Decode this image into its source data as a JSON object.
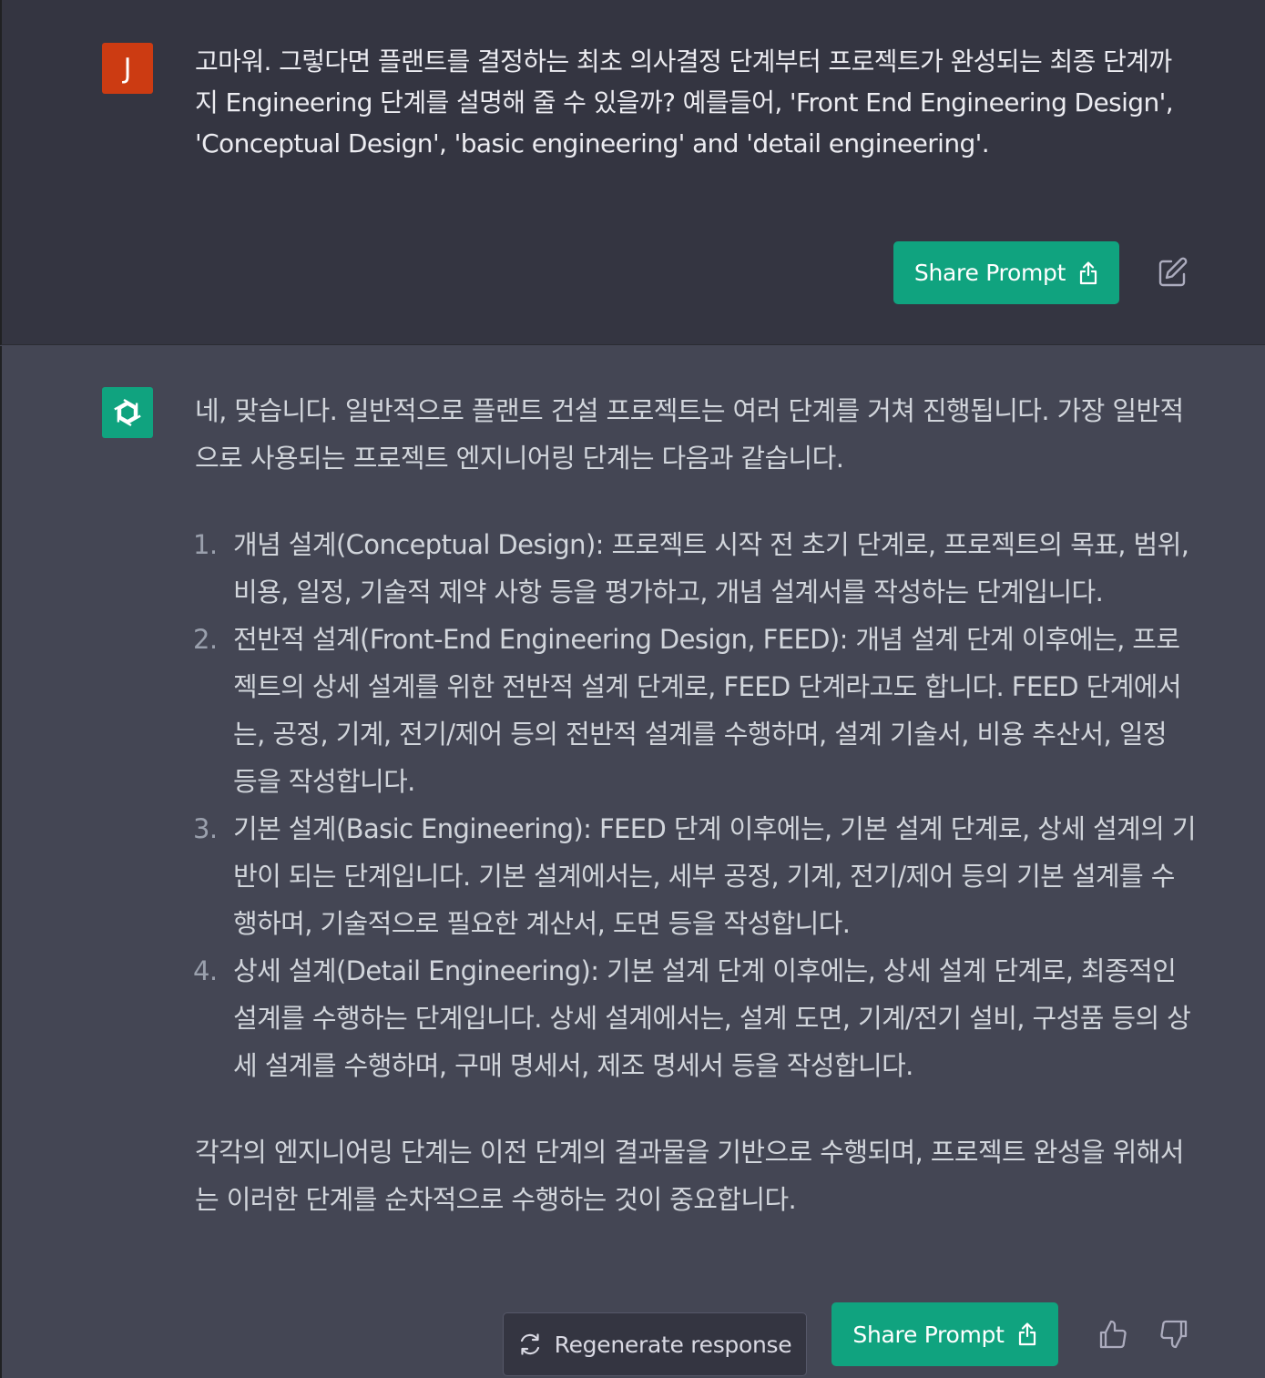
{
  "user_message": {
    "avatar_letter": "J",
    "text": "고마워. 그렇다면 플랜트를 결정하는 최초 의사결정 단계부터 프로젝트가 완성되는 최종 단계까지 Engineering 단계를 설명해 줄 수 있을까? 예를들어, 'Front End Engineering Design', 'Conceptual Design', 'basic engineering' and 'detail engineering'.",
    "share_label": "Share Prompt"
  },
  "assistant_message": {
    "intro": "네, 맞습니다. 일반적으로 플랜트 건설 프로젝트는 여러 단계를 거쳐 진행됩니다. 가장 일반적으로 사용되는 프로젝트 엔지니어링 단계는 다음과 같습니다.",
    "items": [
      {
        "num": "1.",
        "text": "개념 설계(Conceptual Design): 프로젝트 시작 전 초기 단계로, 프로젝트의 목표, 범위, 비용, 일정, 기술적 제약 사항 등을 평가하고, 개념 설계서를 작성하는 단계입니다."
      },
      {
        "num": "2.",
        "text": "전반적 설계(Front-End Engineering Design, FEED): 개념 설계 단계 이후에는, 프로젝트의 상세 설계를 위한 전반적 설계 단계로, FEED 단계라고도 합니다. FEED 단계에서는, 공정, 기계, 전기/제어 등의 전반적 설계를 수행하며, 설계 기술서, 비용 추산서, 일정 등을 작성합니다."
      },
      {
        "num": "3.",
        "text": "기본 설계(Basic Engineering): FEED 단계 이후에는, 기본 설계 단계로, 상세 설계의 기반이 되는 단계입니다. 기본 설계에서는, 세부 공정, 기계, 전기/제어 등의 기본 설계를 수행하며, 기술적으로 필요한 계산서, 도면 등을 작성합니다."
      },
      {
        "num": "4.",
        "text": "상세 설계(Detail Engineering): 기본 설계 단계 이후에는, 상세 설계 단계로, 최종적인 설계를 수행하는 단계입니다. 상세 설계에서는, 설계 도면, 기계/전기 설비, 구성품 등의 상세 설계를 수행하며, 구매 명세서, 제조 명세서 등을 작성합니다."
      }
    ],
    "conclusion": "각각의 엔지니어링 단계는 이전 단계의 결과물을 기반으로 수행되며, 프로젝트 완성을 위해서는 이러한 단계를 순차적으로 수행하는 것이 중요합니다.",
    "share_label": "Share Prompt",
    "regenerate_label": "Regenerate response"
  },
  "icons": {
    "share": "share-icon",
    "edit": "edit-icon",
    "regenerate": "refresh-icon",
    "thumbs_up": "thumbs-up-icon",
    "thumbs_down": "thumbs-down-icon",
    "assistant_logo": "openai-logo-icon"
  },
  "colors": {
    "user_bg": "#343541",
    "assistant_bg": "#444654",
    "accent": "#10a37f",
    "user_avatar": "#cc3b12"
  }
}
